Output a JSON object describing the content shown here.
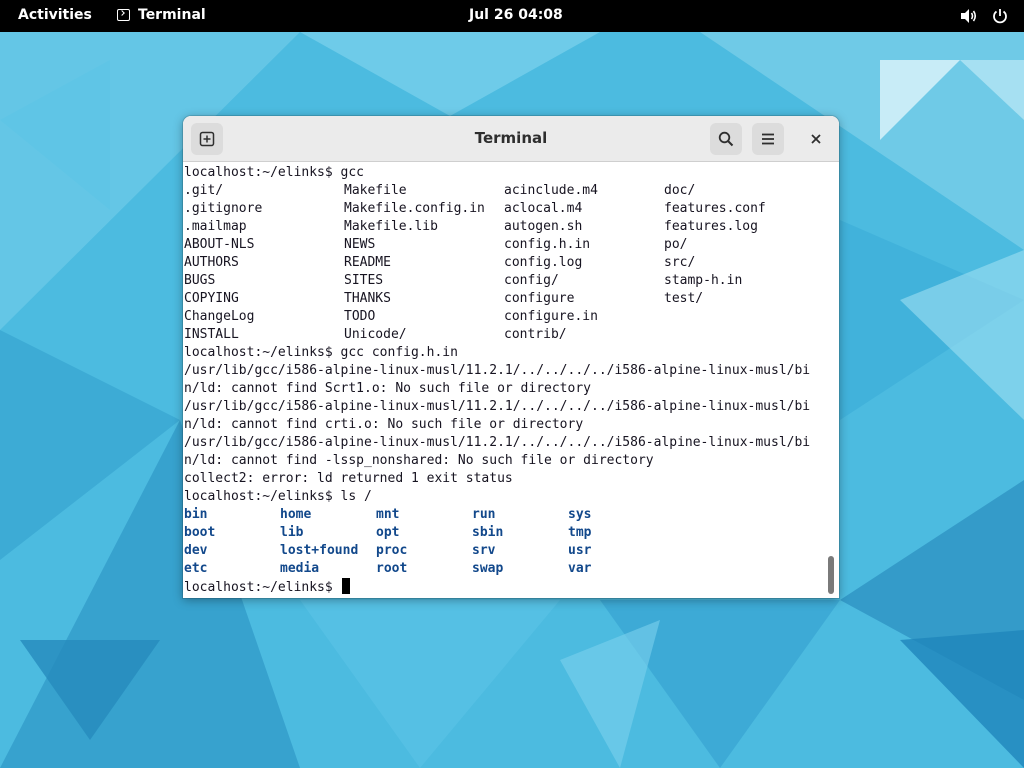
{
  "topbar": {
    "activities": "Activities",
    "app_name": "Terminal",
    "clock": "Jul 26  04:08"
  },
  "window": {
    "title": "Terminal"
  },
  "terminal": {
    "prompt": "localhost:~/elinks$",
    "lines": [
      {
        "type": "prompt",
        "text": "localhost:~/elinks$ gcc"
      },
      {
        "type": "grid",
        "cells": [
          ".git/",
          "Makefile",
          "acinclude.m4",
          "doc/"
        ]
      },
      {
        "type": "grid",
        "cells": [
          ".gitignore",
          "Makefile.config.in",
          "aclocal.m4",
          "features.conf"
        ]
      },
      {
        "type": "grid",
        "cells": [
          ".mailmap",
          "Makefile.lib",
          "autogen.sh",
          "features.log"
        ]
      },
      {
        "type": "grid",
        "cells": [
          "ABOUT-NLS",
          "NEWS",
          "config.h.in",
          "po/"
        ]
      },
      {
        "type": "grid",
        "cells": [
          "AUTHORS",
          "README",
          "config.log",
          "src/"
        ]
      },
      {
        "type": "grid",
        "cells": [
          "BUGS",
          "SITES",
          "config/",
          "stamp-h.in"
        ]
      },
      {
        "type": "grid",
        "cells": [
          "COPYING",
          "THANKS",
          "configure",
          "test/"
        ]
      },
      {
        "type": "grid",
        "cells": [
          "ChangeLog",
          "TODO",
          "configure.in",
          ""
        ]
      },
      {
        "type": "grid",
        "cells": [
          "INSTALL",
          "Unicode/",
          "contrib/",
          ""
        ]
      },
      {
        "type": "prompt",
        "text": "localhost:~/elinks$ gcc config.h.in"
      },
      {
        "type": "text",
        "text": "/usr/lib/gcc/i586-alpine-linux-musl/11.2.1/../../../../i586-alpine-linux-musl/bi"
      },
      {
        "type": "text",
        "text": "n/ld: cannot find Scrt1.o: No such file or directory"
      },
      {
        "type": "text",
        "text": "/usr/lib/gcc/i586-alpine-linux-musl/11.2.1/../../../../i586-alpine-linux-musl/bi"
      },
      {
        "type": "text",
        "text": "n/ld: cannot find crti.o: No such file or directory"
      },
      {
        "type": "text",
        "text": "/usr/lib/gcc/i586-alpine-linux-musl/11.2.1/../../../../i586-alpine-linux-musl/bi"
      },
      {
        "type": "text",
        "text": "n/ld: cannot find -lssp_nonshared: No such file or directory"
      },
      {
        "type": "text",
        "text": "collect2: error: ld returned 1 exit status"
      },
      {
        "type": "prompt",
        "text": "localhost:~/elinks$ ls /"
      },
      {
        "type": "dirgrid",
        "cells": [
          "bin",
          "home",
          "mnt",
          "run",
          "sys"
        ]
      },
      {
        "type": "dirgrid",
        "cells": [
          "boot",
          "lib",
          "opt",
          "sbin",
          "tmp"
        ]
      },
      {
        "type": "dirgrid",
        "cells": [
          "dev",
          "lost+found",
          "proc",
          "srv",
          "usr"
        ]
      },
      {
        "type": "dirgrid",
        "cells": [
          "etc",
          "media",
          "root",
          "swap",
          "var"
        ]
      }
    ],
    "current_input": "localhost:~/elinks$ "
  },
  "icons": {
    "app_icon": "terminal-icon",
    "volume": "volume-icon",
    "power": "power-icon",
    "new_tab": "new-tab-icon",
    "search": "search-icon",
    "menu": "hamburger-menu-icon",
    "close": "close-icon"
  },
  "colors": {
    "topbar_bg": "#000000",
    "wallpaper": "#49b9de",
    "directory_text": "#12488b",
    "terminal_fg": "#171421"
  }
}
